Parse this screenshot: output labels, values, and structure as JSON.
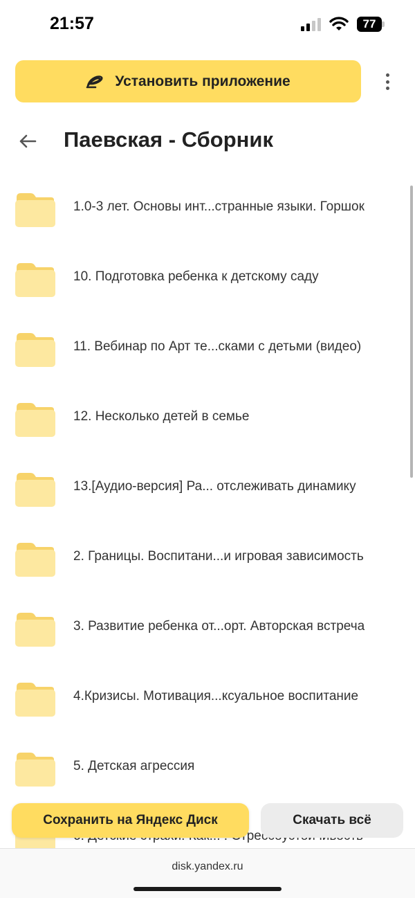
{
  "status_bar": {
    "time": "21:57",
    "battery_level": "77",
    "icons": [
      "cellular-signal-icon",
      "wifi-icon",
      "battery-icon"
    ]
  },
  "install_banner": {
    "label": "Установить приложение",
    "icon": "yandex-disk-logo-icon",
    "more_icon": "more-vertical-icon"
  },
  "header": {
    "back_icon": "arrow-left-icon",
    "title": "Паевская - Сборник"
  },
  "folders": [
    "1.0-3 лет. Основы инт...странные языки. Горшок",
    "10. Подготовка ребенка к детскому саду",
    "11. Вебинар по Арт те...сками с детьми (видео)",
    "12. Несколько детей в семье",
    "13.[Аудио-версия] Ра... отслеживать динамику",
    "2. Границы. Воспитани...и игровая зависимость",
    "3. Развитие ребенка от...орт. Авторская встреча",
    "4.Кризисы. Мотивация...ксуальное воспитание",
    "5. Детская агрессия",
    "6. Детские страхи. Как... . Стрессоустойчивость"
  ],
  "actions": {
    "save_label": "Сохранить на Яндекс Диск",
    "download_label": "Скачать всё"
  },
  "browser": {
    "url": "disk.yandex.ru"
  },
  "colors": {
    "accent_yellow": "#ffdc60",
    "folder_yellow": "#fde8a0",
    "secondary_button": "#ececec"
  }
}
